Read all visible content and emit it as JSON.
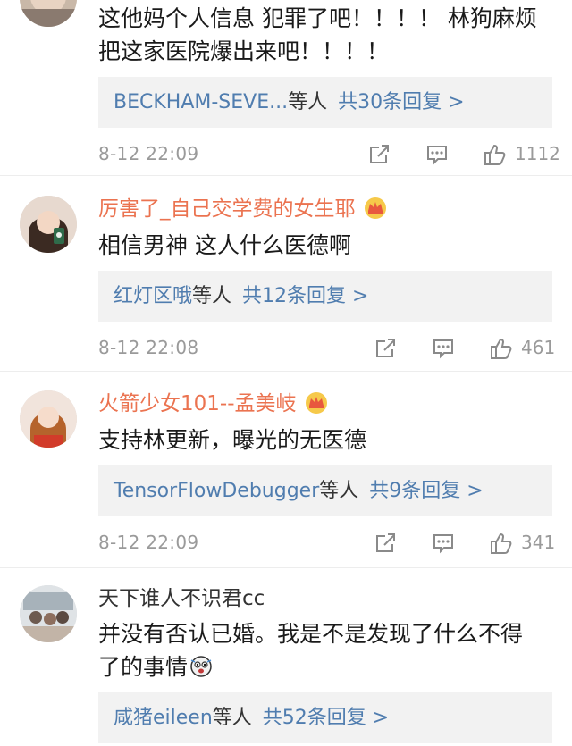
{
  "comments": [
    {
      "text_lines": [
        "这他妈个人信息 犯罪了吧！！！！ 林狗麻烦",
        "把这家医院爆出来吧！！！！"
      ],
      "reply": {
        "names": "BECKHAM-SEVE...",
        "suffix": "等人",
        "count": "共30条回复 >"
      },
      "time": "8-12 22:09",
      "likes": "1112"
    },
    {
      "username": "厉害了_自己交学费的女生耶",
      "text_lines": [
        "相信男神 这人什么医德啊"
      ],
      "reply": {
        "names": "红灯区哦",
        "suffix": "等人",
        "count": "共12条回复 >"
      },
      "time": "8-12 22:08",
      "likes": "461"
    },
    {
      "username": "火箭少女101--孟美岐",
      "text_lines": [
        "支持林更新，曝光的无医德"
      ],
      "reply": {
        "names": "TensorFlowDebugger",
        "suffix": "等人",
        "count": "共9条回复 >"
      },
      "time": "8-12 22:09",
      "likes": "341"
    },
    {
      "username": "天下谁人不识君cc",
      "text_lines": [
        "并没有否认已婚。我是不是发现了什么不得",
        "了的事情"
      ],
      "reply": {
        "names": "咸猪eileen",
        "suffix": "等人",
        "count": "共52条回复 >"
      }
    }
  ],
  "colors": {
    "vip_name": "#eb7350",
    "link": "#507daf",
    "reply_bg": "#f2f2f2",
    "meta": "#9a9a9a"
  },
  "icons": {
    "share": "share-icon",
    "comment": "comment-icon",
    "like": "thumbs-up-icon",
    "vip": "crown-icon",
    "emoji": "scared-face-emoji"
  }
}
